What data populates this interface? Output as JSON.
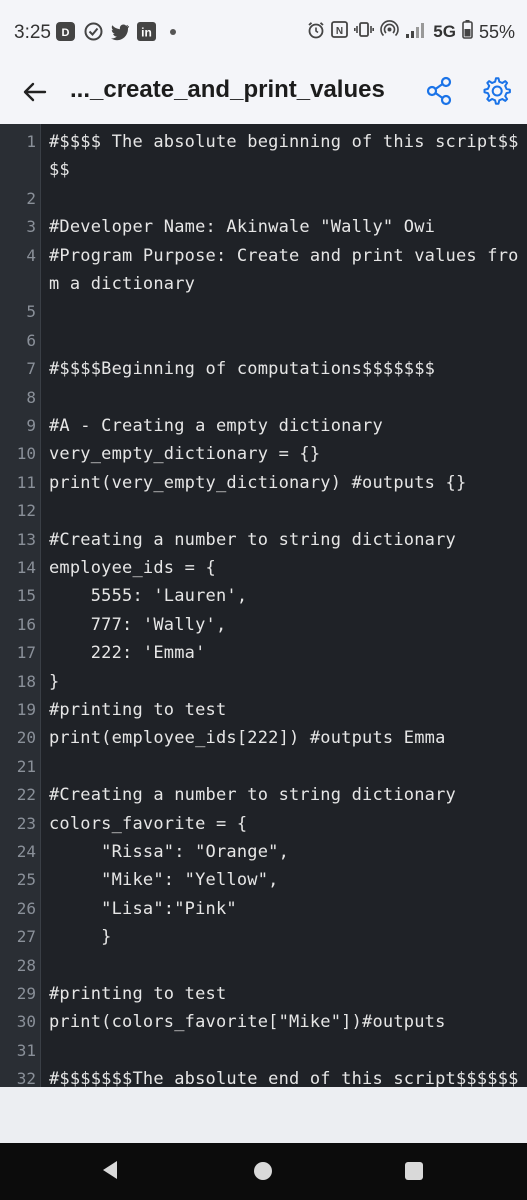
{
  "status_bar": {
    "time": "3:25",
    "network": "5G",
    "battery": "55%",
    "icons": [
      "disney-app-icon",
      "check-circle-icon",
      "twitter-icon",
      "linkedin-icon",
      "alarm-icon",
      "nfc-icon",
      "vibrate-icon",
      "hotspot-icon",
      "signal-icon",
      "battery-icon"
    ]
  },
  "app_bar": {
    "title": "..._create_and_print_values",
    "accent_color": "#1a73e8"
  },
  "editor": {
    "lines": [
      {
        "num": "1",
        "text": "#$$$$ The absolute beginning of this script$$"
      },
      {
        "num": "",
        "text": "$$"
      },
      {
        "num": "2",
        "text": ""
      },
      {
        "num": "3",
        "text": "#Developer Name: Akinwale \"Wally\" Owi"
      },
      {
        "num": "4",
        "text": "#Program Purpose: Create and print values fro"
      },
      {
        "num": "",
        "text": "m a dictionary"
      },
      {
        "num": "5",
        "text": ""
      },
      {
        "num": "6",
        "text": ""
      },
      {
        "num": "7",
        "text": "#$$$$Beginning of computations$$$$$$$"
      },
      {
        "num": "8",
        "text": ""
      },
      {
        "num": "9",
        "text": "#A - Creating a empty dictionary"
      },
      {
        "num": "10",
        "text": "very_empty_dictionary = {}"
      },
      {
        "num": "11",
        "text": "print(very_empty_dictionary) #outputs {}"
      },
      {
        "num": "12",
        "text": ""
      },
      {
        "num": "13",
        "text": "#Creating a number to string dictionary"
      },
      {
        "num": "14",
        "text": "employee_ids = {"
      },
      {
        "num": "15",
        "text": "    5555: 'Lauren',"
      },
      {
        "num": "16",
        "text": "    777: 'Wally',"
      },
      {
        "num": "17",
        "text": "    222: 'Emma'"
      },
      {
        "num": "18",
        "text": "}"
      },
      {
        "num": "19",
        "text": "#printing to test"
      },
      {
        "num": "20",
        "text": "print(employee_ids[222]) #outputs Emma"
      },
      {
        "num": "21",
        "text": ""
      },
      {
        "num": "22",
        "text": "#Creating a number to string dictionary"
      },
      {
        "num": "23",
        "text": "colors_favorite = {"
      },
      {
        "num": "24",
        "text": "     \"Rissa\": \"Orange\","
      },
      {
        "num": "25",
        "text": "     \"Mike\": \"Yellow\","
      },
      {
        "num": "26",
        "text": "     \"Lisa\":\"Pink\""
      },
      {
        "num": "27",
        "text": "     }"
      },
      {
        "num": "28",
        "text": ""
      },
      {
        "num": "29",
        "text": "#printing to test"
      },
      {
        "num": "30",
        "text": "print(colors_favorite[\"Mike\"])#outputs"
      },
      {
        "num": "31",
        "text": ""
      },
      {
        "num": "32",
        "text": "#$$$$$$$The absolute end of this script$$$$$$"
      }
    ]
  },
  "nav_bar": {
    "buttons": [
      "back-nav-icon",
      "home-nav-icon",
      "recents-nav-icon"
    ]
  }
}
